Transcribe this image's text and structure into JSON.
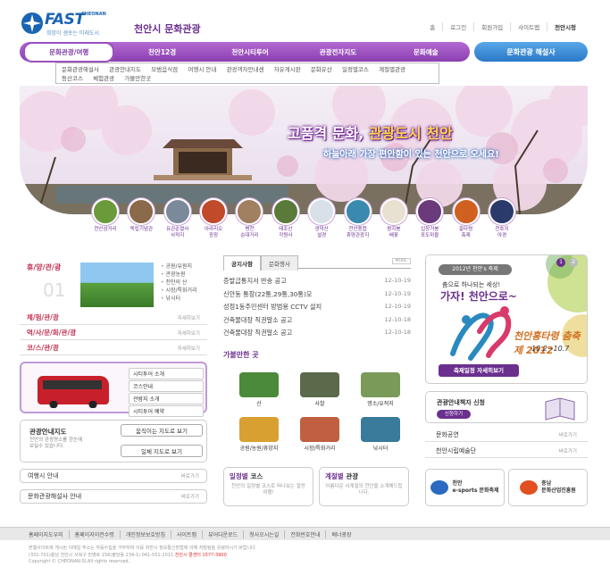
{
  "header": {
    "logo_text": "FAST",
    "logo_sub": "CHEONAN",
    "logo_slogan": "희망이 샘솟는 미래도시",
    "site_title": "천안시 문화관광",
    "top_links": [
      "홈",
      "로그인",
      "회원가입",
      "사이트맵",
      "천안시청"
    ]
  },
  "gnb": {
    "items": [
      "문화관광/여행",
      "천안12경",
      "천안시티투어",
      "관광전자지도",
      "문화예술"
    ],
    "tour_button": "문화관광 해설사"
  },
  "submenu": {
    "items": [
      "문화관광해설사",
      "관광안내지도",
      "모범음식점",
      "여행시 안내",
      "관광객자안내센",
      "자유게시판",
      "문화유산",
      "일정별코스",
      "계절별관광",
      "등산코스",
      "체험관광",
      "가볼만한곳"
    ]
  },
  "hero": {
    "title_a": "고품격 문화, ",
    "title_b": "관광도시 천안",
    "subtitle": "하늘아래 가장 편안함이 있는 천안으로 오세요!"
  },
  "thumbs": [
    {
      "label": "천안삼거리",
      "color": "#6a9a3a"
    },
    {
      "label": "독립기념관",
      "color": "#8a6a4a"
    },
    {
      "label": "유관순열사\n사적지",
      "color": "#7a8a9a"
    },
    {
      "label": "아라리오\n광장",
      "color": "#c04a2a"
    },
    {
      "label": "병천\n순대거리",
      "color": "#a08060"
    },
    {
      "label": "태조산\n각원사",
      "color": "#5a7a3a"
    },
    {
      "label": "광덕산\n설경",
      "color": "#d8e0e8"
    },
    {
      "label": "천안종합\n휴양관광지",
      "color": "#3a8ab0"
    },
    {
      "label": "왕지봉\n배꽃",
      "color": "#e8e0d0"
    },
    {
      "label": "입장거봉\n포도마을",
      "color": "#6a3a7a"
    },
    {
      "label": "흥타령\n축제",
      "color": "#d06020"
    },
    {
      "label": "천호지\n야경",
      "color": "#2a3a6a"
    }
  ],
  "left": {
    "hyu_title": "휴/양/관/광",
    "hyu_num": "01",
    "hyu_list": [
      "공원/유원지",
      "관광농원",
      "천안의 산",
      "시장/특화거리",
      "낚시터"
    ],
    "categories": [
      {
        "title": "체/험/관/광",
        "more": "자세히보기"
      },
      {
        "title": "역/사/문/화/관/광",
        "more": "자세히보기"
      },
      {
        "title": "코/스/관/광",
        "more": "자세히보기"
      }
    ],
    "bus_list": [
      "시티투어 소개",
      "코스안내",
      "관람지 소개",
      "시티투어 예약"
    ],
    "map": {
      "title": "관광안내지도",
      "desc": "천안의 관광명소를 한눈에 보실수 있습니다.",
      "btn1": "움직이는 지도로 보기",
      "btn2": "일체 지도로 보기"
    },
    "rows": [
      {
        "title": "여행시 안내",
        "more": "바로가기"
      },
      {
        "title": "문화관광해설사 안내",
        "more": "바로가기"
      }
    ]
  },
  "center": {
    "tabs": [
      "공지사항",
      "문화행사"
    ],
    "more": "MORE",
    "notices": [
      {
        "title": "증발급통지서 반송 공고",
        "date": "12-10-19"
      },
      {
        "title": "신안동 통장(22통,29통,30통)모",
        "date": "12-10-19"
      },
      {
        "title": "성정1동주민센터 방범용 CCTV 설치",
        "date": "12-10-19"
      },
      {
        "title": "건축물대장 직권말소 공고",
        "date": "12-10-18"
      },
      {
        "title": "건축물대장 직권말소 공고",
        "date": "12-10-18"
      }
    ],
    "fun_title": "가볼만한 곳",
    "fun_items": [
      {
        "label": "산",
        "color": "#4a8a3a"
      },
      {
        "label": "사찰",
        "color": "#5a6a4a"
      },
      {
        "label": "명소/유적지",
        "color": "#7a9a5a"
      },
      {
        "label": "공원/농원/휴양지",
        "color": "#d8a030"
      },
      {
        "label": "시장/특화거리",
        "color": "#c06040"
      },
      {
        "label": "낚시터",
        "color": "#3a7a9a"
      }
    ],
    "course": {
      "title_a": "일정별 ",
      "title_b": "코스",
      "desc": "천안의 일정별 코스로 떠나보는 알찬여행!"
    },
    "season": {
      "title_a": "계절별 ",
      "title_b": "관광",
      "desc": "아름다운 사계절의 천안을 소개해드립니다."
    }
  },
  "right": {
    "festival": {
      "pill": "2012년 천안's 축제",
      "line1": "춤으로 하나되는 세상!",
      "line2": "가자! 천안으로~",
      "name": "천안흥타령 춤축제 2012",
      "dates": "10.2~10.7",
      "button": "축제일정 자세히보기",
      "pages": [
        "1",
        "2"
      ]
    },
    "guide": {
      "title": "관광안내책자 신청",
      "button": "신청하기"
    },
    "rows": [
      {
        "title": "문화공연",
        "more": "바로가기"
      },
      {
        "title": "천안시립예술단",
        "more": "바로가기"
      }
    ],
    "banners": [
      {
        "text": "천안\ne-sports 문화축제",
        "color": "#2a6ac0"
      },
      {
        "text": "충남\n문화산업진흥원",
        "color": "#e05020"
      }
    ]
  },
  "footer": {
    "links": [
      "홈페이지도우미",
      "홈페이지이전수령",
      "개인정보보호방침",
      "사이트맵",
      "뷰어다운로드",
      "청사오시는길",
      "전화번호안내",
      "배너광장"
    ],
    "address": "본웹사이트에 게시된 이메일 주소는 자동수집을 거부하며 이를 위반시 정보통신망법에 의해 처벌됨을 유념하시기 바랍니다.",
    "contact_a": "(331-701)충남 천안시 서북구 번영로 156(불당동 234-1) 041-551-2011 ",
    "contact_b": "천안시 콜센터 1577-3900",
    "copyright": "Copyright © CHEONAN-SI.All rights reserved."
  }
}
